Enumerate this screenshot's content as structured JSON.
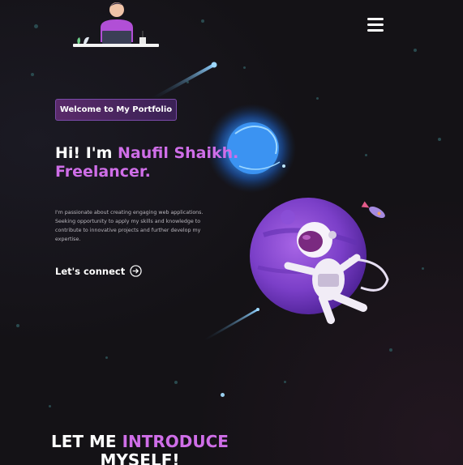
{
  "header": {
    "logo_icon": "person-at-laptop-icon",
    "menu_icon": "hamburger-icon"
  },
  "hero": {
    "badge": "Welcome to My Portfolio",
    "greeting": "Hi! I'm",
    "name": "Naufil Shaikh.",
    "role": "Freelancer.",
    "description": "I'm passionate about creating engaging web applications. Seeking opportunity to apply my skills and knowledge to contribute to innovative projects and further develop my expertise.",
    "cta_label": "Let's connect",
    "cta_icon": "arrow-right-circle-icon"
  },
  "illustration": {
    "icons": [
      "glowing-planet-icon",
      "purple-planet-icon",
      "astronaut-icon",
      "rocket-icon",
      "comet-icon"
    ]
  },
  "about": {
    "title_part1": "LET ME",
    "title_accent": "INTRODUCE",
    "title_part2": "MYSELF!"
  },
  "colors": {
    "accent": "#cf6ee8",
    "background": "#141216",
    "badge": "#4a2560"
  }
}
